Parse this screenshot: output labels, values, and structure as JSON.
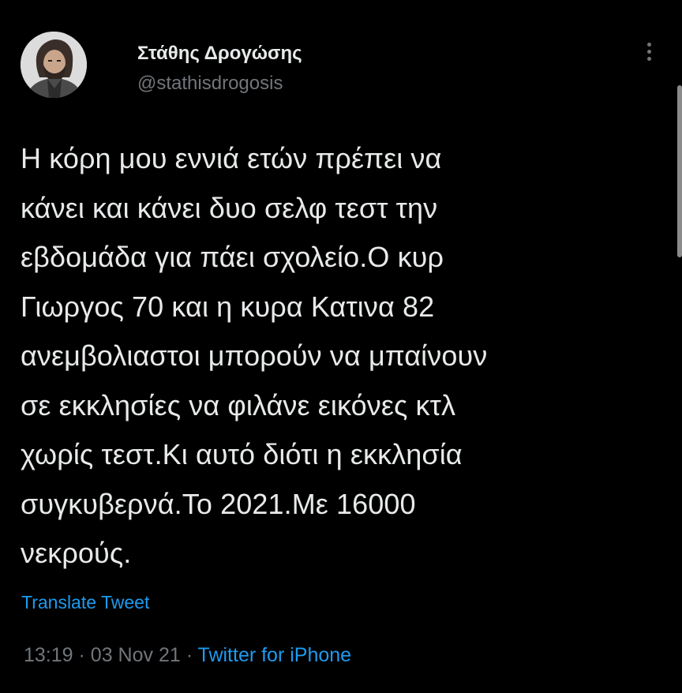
{
  "tweet": {
    "author": {
      "display_name": "Στάθης Δρογώσης",
      "handle": "@stathisdrogosis",
      "avatar_icon": "user-avatar-photo"
    },
    "more_icon": "more-vertical-icon",
    "text_lines": [
      "Η κόρη μου εννιά ετών πρέπει να",
      "κάνει και κάνει δυο σελφ τεστ την",
      "εβδομάδα για πάει σχολείο.Ο κυρ",
      "Γιωργος 70 και η κυρα Κατινα 82",
      "ανεμβολιαστοι μπορούν να μπαίνουν",
      "σε εκκλησίες να φιλάνε εικόνες κτλ",
      "χωρίς τεστ.Κι αυτό διότι η εκκλησία",
      "συγκυβερνά.Το 2021.Με 16000",
      "νεκρούς."
    ],
    "translate_label": "Translate Tweet",
    "time": "13:19",
    "separator": "·",
    "date": "03 Nov 21",
    "source": "Twitter for iPhone"
  },
  "colors": {
    "background": "#000000",
    "text_primary": "#e7e9ea",
    "text_secondary": "#71767b",
    "accent": "#1d9bf0"
  }
}
